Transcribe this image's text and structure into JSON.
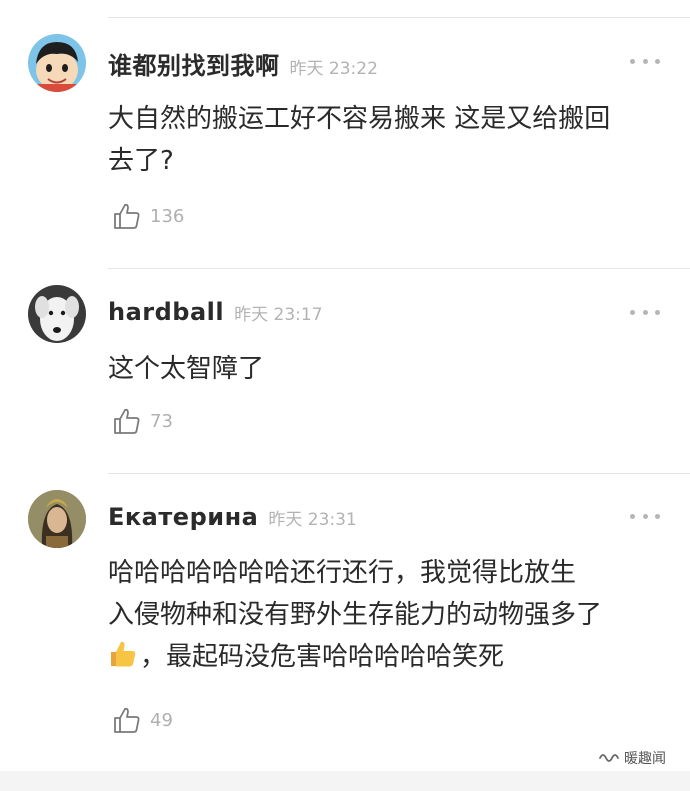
{
  "comments": [
    {
      "username": "谁都别找到我啊",
      "time": "昨天 23:22",
      "text_lines": [
        "大自然的搬运工好不容易搬来 这是又给搬回",
        "去了?"
      ],
      "likes": "136",
      "avatar_icon": "cartoon-boy-avatar"
    },
    {
      "username": "hardball",
      "time": "昨天 23:17",
      "text_lines": [
        "这个太智障了"
      ],
      "likes": "73",
      "avatar_icon": "white-dog-avatar"
    },
    {
      "username": "Екатерина",
      "time": "昨天 23:31",
      "text_lines": [
        "哈哈哈哈哈哈哈还行还行，我觉得比放生",
        "入侵物种和没有野外生存能力的动物强多了",
        "，最起码没危害哈哈哈哈哈笑死"
      ],
      "emoji_icon": "thumbs-up-emoji",
      "likes": "49",
      "avatar_icon": "woman-portrait-avatar"
    }
  ],
  "watermark": {
    "label": "暖趣闻",
    "icon": "wechat-channel-icon"
  },
  "colors": {
    "text": "#2a2a2a",
    "muted": "#b3b3b3",
    "divider": "#e6e6e6"
  }
}
